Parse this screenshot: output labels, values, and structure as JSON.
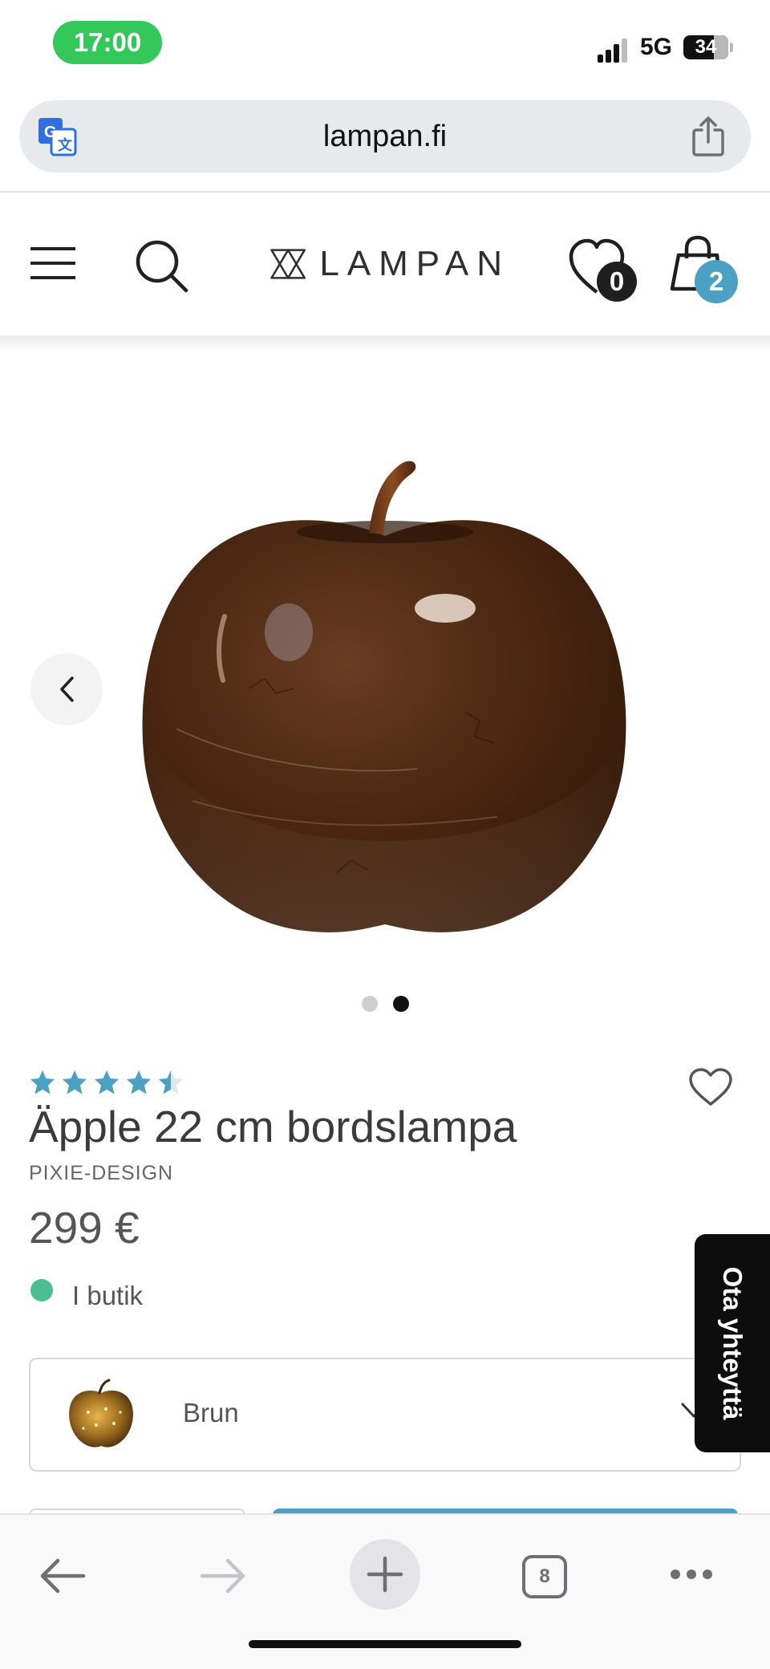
{
  "status_bar": {
    "time": "17:00",
    "network": "5G",
    "battery": "34"
  },
  "browser": {
    "url": "lampan.fi",
    "tab_count": "8"
  },
  "site_header": {
    "logo_text": "LAMPAN",
    "wishlist_count": "0",
    "cart_count": "2"
  },
  "gallery": {
    "image_count": 2,
    "active_index": 1
  },
  "product": {
    "rating": 4.5,
    "title": "Äpple 22 cm bordslampa",
    "brand": "PIXIE-DESIGN",
    "price": "299 €",
    "stock_status": "I butik",
    "variant": "Brun"
  },
  "contact_tab": "Ota yhteyttä",
  "icons": {
    "translate": "translate-icon",
    "share": "share-icon",
    "menu": "menu-icon",
    "search": "search-icon",
    "wishlist": "heart-icon",
    "cart": "shopping-bag-icon",
    "prev": "chevron-left-icon",
    "favorite": "heart-outline-icon",
    "dropdown": "chevron-down-icon",
    "back": "arrow-left-icon",
    "forward": "arrow-right-icon",
    "new_tab": "plus-icon",
    "more": "more-icon"
  },
  "colors": {
    "accent": "#4aa1c1",
    "in_stock": "#4bbf8f",
    "time_pill": "#34c759",
    "contact_tab": "#0d0d0d"
  }
}
